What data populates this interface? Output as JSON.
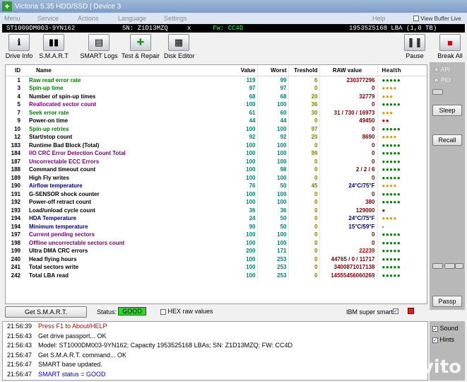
{
  "window": {
    "title": "Victoria 5.35 HDD/SSD | Device 3",
    "icon_char": "+"
  },
  "menu": [
    "Menu",
    "Service",
    "Actions",
    "Language",
    "Settings",
    "Help"
  ],
  "view_buffer_live": "View Buffer Live",
  "device": {
    "model": "ST1000DM003-9YN162",
    "serial": "SN: Z1D13MZQ",
    "close": "x",
    "firmware": "Fw: CC4D",
    "lba": "1953525168 LBA (1,0 TB)"
  },
  "toolbar": [
    {
      "name": "drive-info-button",
      "icon": "info-icon",
      "glyph": "ℹ",
      "label": "Drive Info"
    },
    {
      "name": "smart-button",
      "icon": "smart-chart-icon",
      "glyph": "▮▮",
      "label": "S.M.A.R.T"
    },
    {
      "name": "smart-logs-button",
      "icon": "logs-icon",
      "glyph": "▤",
      "label": "SMART Logs"
    },
    {
      "name": "test-repair-button",
      "icon": "test-repair-icon",
      "glyph": "✚",
      "label": "Test & Repair"
    },
    {
      "name": "disk-editor-button",
      "icon": "disk-editor-icon",
      "glyph": "▦",
      "label": "Disk Editor"
    },
    {
      "name": "pause-button",
      "icon": "pause-icon",
      "glyph": "❚❚",
      "label": "Pause"
    },
    {
      "name": "break-all-button",
      "icon": "break-all-icon",
      "glyph": "■",
      "label": "Break All"
    }
  ],
  "columns": [
    "ID",
    "Name",
    "Value",
    "Worst",
    "Treshold",
    "RAW value",
    "Health"
  ],
  "rows": [
    {
      "id": "1",
      "name": "Raw read error rate",
      "value": "119",
      "worst": "99",
      "tresh": "6",
      "raw": "230377296",
      "health": "●●●●●",
      "color": "#008000",
      "rawcolor": "#800000",
      "hcolor": "#008000"
    },
    {
      "id": "3",
      "name": "Spin-up time",
      "value": "97",
      "worst": "97",
      "tresh": "0",
      "raw": "0",
      "health": "●●●●",
      "color": "#008000",
      "rawcolor": "#800000",
      "hcolor": "#d4a000"
    },
    {
      "id": "4",
      "name": "Number of spin-up times",
      "value": "68",
      "worst": "68",
      "tresh": "20",
      "raw": "32779",
      "health": "●●●",
      "color": "#000000",
      "rawcolor": "#800000",
      "hcolor": "#d4a000"
    },
    {
      "id": "5",
      "name": "Reallocated sector count",
      "value": "100",
      "worst": "100",
      "tresh": "36",
      "raw": "0",
      "health": "●●●●●",
      "color": "#800080",
      "rawcolor": "#800000",
      "hcolor": "#008000"
    },
    {
      "id": "7",
      "name": "Seek error rate",
      "value": "61",
      "worst": "60",
      "tresh": "30",
      "raw": "31 / 730 / 16973",
      "health": "●●●",
      "color": "#008000",
      "rawcolor": "#800000",
      "hcolor": "#d4a000"
    },
    {
      "id": "9",
      "name": "Power-on time",
      "value": "44",
      "worst": "44",
      "tresh": "0",
      "raw": "49450",
      "health": "●●",
      "color": "#000000",
      "rawcolor": "#800000",
      "hcolor": "#c00000"
    },
    {
      "id": "10",
      "name": "Spin-up retries",
      "value": "100",
      "worst": "100",
      "tresh": "97",
      "raw": "0",
      "health": "●●●●●",
      "color": "#008000",
      "rawcolor": "#800000",
      "hcolor": "#008000"
    },
    {
      "id": "12",
      "name": "Start/stop count",
      "value": "92",
      "worst": "92",
      "tresh": "20",
      "raw": "8690",
      "health": "●●●●",
      "color": "#000000",
      "rawcolor": "#800000",
      "hcolor": "#d4a000"
    },
    {
      "id": "183",
      "name": "Runtime Bad Block (Total)",
      "value": "100",
      "worst": "100",
      "tresh": "0",
      "raw": "0",
      "health": "●●●●●",
      "color": "#000000",
      "rawcolor": "#800000",
      "hcolor": "#008000"
    },
    {
      "id": "184",
      "name": "I/O CRC Error Detection Count Total",
      "value": "100",
      "worst": "100",
      "tresh": "99",
      "raw": "0",
      "health": "●●●●●",
      "color": "#800080",
      "rawcolor": "#800000",
      "hcolor": "#008000"
    },
    {
      "id": "187",
      "name": "Uncorrectable ECC Errors",
      "value": "100",
      "worst": "100",
      "tresh": "0",
      "raw": "0",
      "health": "●●●●●",
      "color": "#800080",
      "rawcolor": "#800000",
      "hcolor": "#008000"
    },
    {
      "id": "188",
      "name": "Command timeout count",
      "value": "100",
      "worst": "98",
      "tresh": "0",
      "raw": "2 / 2 / 6",
      "health": "●●●●●",
      "color": "#000000",
      "rawcolor": "#800000",
      "hcolor": "#008000"
    },
    {
      "id": "189",
      "name": "High Fly writes",
      "value": "100",
      "worst": "100",
      "tresh": "0",
      "raw": "0",
      "health": "●●●●●",
      "color": "#000000",
      "rawcolor": "#800000",
      "hcolor": "#008000"
    },
    {
      "id": "190",
      "name": "Airflow temperature",
      "value": "76",
      "worst": "50",
      "tresh": "45",
      "raw": "24°C/75°F",
      "health": "●●●●",
      "color": "#000080",
      "rawcolor": "#000080",
      "hcolor": "#d4a000"
    },
    {
      "id": "191",
      "name": "G-SENSOR shock counter",
      "value": "100",
      "worst": "100",
      "tresh": "0",
      "raw": "0",
      "health": "●●●●●",
      "color": "#000000",
      "rawcolor": "#800000",
      "hcolor": "#008000"
    },
    {
      "id": "192",
      "name": "Power-off retract count",
      "value": "100",
      "worst": "100",
      "tresh": "0",
      "raw": "380",
      "health": "●●●●●",
      "color": "#000000",
      "rawcolor": "#800000",
      "hcolor": "#008000"
    },
    {
      "id": "193",
      "name": "Load/unload cycle count",
      "value": "36",
      "worst": "36",
      "tresh": "0",
      "raw": "129000",
      "health": "●",
      "color": "#000000",
      "rawcolor": "#800000",
      "hcolor": "#c00000"
    },
    {
      "id": "194",
      "name": "HDA Temperature",
      "value": "24",
      "worst": "50",
      "tresh": "0",
      "raw": "24°C/75°F",
      "health": "●●●●",
      "color": "#000080",
      "rawcolor": "#000080",
      "hcolor": "#d4a000"
    },
    {
      "id": "194",
      "name": "Minimum temperature",
      "value": "90",
      "worst": "50",
      "tresh": "0",
      "raw": "15°C/59°F",
      "health": "-",
      "color": "#000080",
      "rawcolor": "#000080",
      "hcolor": "#000000"
    },
    {
      "id": "197",
      "name": "Current pending sectors",
      "value": "100",
      "worst": "100",
      "tresh": "0",
      "raw": "0",
      "health": "●●●●●",
      "color": "#800080",
      "rawcolor": "#800000",
      "hcolor": "#008000"
    },
    {
      "id": "198",
      "name": "Offline uncorrectable sectors count",
      "value": "100",
      "worst": "100",
      "tresh": "0",
      "raw": "0",
      "health": "●●●●●",
      "color": "#800080",
      "rawcolor": "#800000",
      "hcolor": "#008000"
    },
    {
      "id": "199",
      "name": "Ultra DMA CRC errors",
      "value": "200",
      "worst": "171",
      "tresh": "0",
      "raw": "22239",
      "health": "●●●●●",
      "color": "#000000",
      "rawcolor": "#c00000",
      "hcolor": "#008000"
    },
    {
      "id": "240",
      "name": "Head flying hours",
      "value": "100",
      "worst": "253",
      "tresh": "0",
      "raw": "44765 / 0 / 11717",
      "health": "●●●●●",
      "color": "#000000",
      "rawcolor": "#800000",
      "hcolor": "#008000"
    },
    {
      "id": "241",
      "name": "Total sectors write",
      "value": "100",
      "worst": "253",
      "tresh": "0",
      "raw": "3400871017138",
      "health": "●●●●●",
      "color": "#000000",
      "rawcolor": "#800000",
      "hcolor": "#008000"
    },
    {
      "id": "242",
      "name": "Total LBA read",
      "value": "100",
      "worst": "253",
      "tresh": "0",
      "raw": "14555456060269",
      "health": "●●●●●",
      "color": "#000000",
      "rawcolor": "#800000",
      "hcolor": "#008000"
    }
  ],
  "side_panel": {
    "api": "API",
    "pio": "PIO",
    "sleep": "Sleep",
    "recall": "Recall",
    "passp": "Passp"
  },
  "bottom": {
    "get_smart": "Get S.M.A.R.T.",
    "status_label": "Status:",
    "status_value": "GOOD",
    "hex_raw": "HEX raw values",
    "ibm": "IBM super smart:"
  },
  "log": [
    {
      "time": "21:56:39",
      "text": "Press F1 to About/HELP",
      "color": "#c00000"
    },
    {
      "time": "21:56:43",
      "text": "Get drive passport... OK",
      "color": "#000000"
    },
    {
      "time": "21:56:43",
      "text": "Model: ST1000DM003-9YN162; Capacity 1953525168 LBAs; SN: Z1D13MZQ; FW: CC4D",
      "color": "#000000"
    },
    {
      "time": "21:56:47",
      "text": "Get S.M.A.R.T. command... OK",
      "color": "#000000"
    },
    {
      "time": "21:56:47",
      "text": "SMART base updated.",
      "color": "#000000"
    },
    {
      "time": "21:56:47",
      "text": "SMART status = GOOD",
      "color": "#0000c0"
    }
  ],
  "log_side": {
    "sound": "Sound",
    "hints": "Hints"
  },
  "watermark": "Avito",
  "colors": {
    "status_good_bg": "#22dd22",
    "device_bar_bg": "#000000",
    "title_bar": "#8aa8cc",
    "ibm_red": "#e02020"
  }
}
